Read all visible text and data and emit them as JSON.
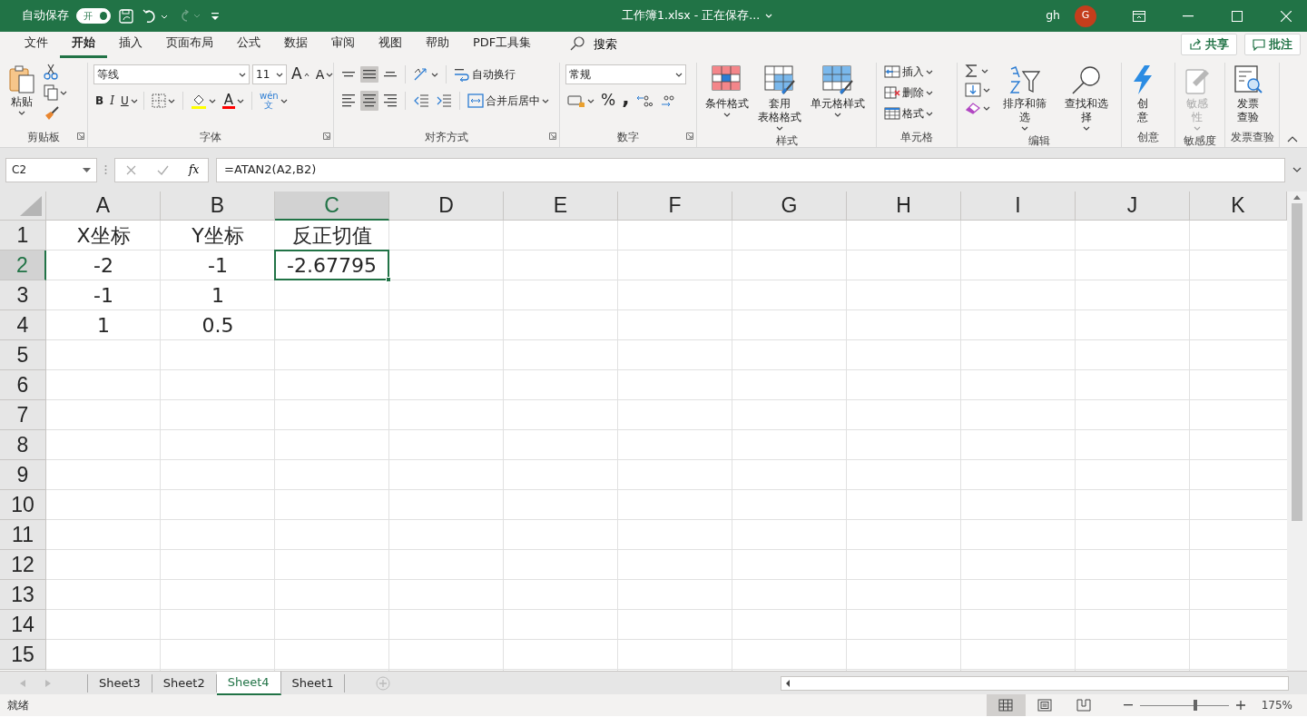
{
  "title_bar": {
    "autosave": {
      "label": "自动保存",
      "toggle_text": "开",
      "on": true
    },
    "redo_disabled": true,
    "title": "工作簿1.xlsx - 正在保存...",
    "user": "gh",
    "avatar": "G"
  },
  "menu_tabs": [
    {
      "label": "文件",
      "selected": false
    },
    {
      "label": "开始",
      "selected": true
    },
    {
      "label": "插入",
      "selected": false
    },
    {
      "label": "页面布局",
      "selected": false
    },
    {
      "label": "公式",
      "selected": false
    },
    {
      "label": "数据",
      "selected": false
    },
    {
      "label": "审阅",
      "selected": false
    },
    {
      "label": "视图",
      "selected": false
    },
    {
      "label": "帮助",
      "selected": false
    },
    {
      "label": "PDF工具集",
      "selected": false
    }
  ],
  "search": "搜索",
  "share": "共享",
  "comments": "批注",
  "ribbon": {
    "clipboard": {
      "label": "剪贴板",
      "launcher": true,
      "paste": "粘贴"
    },
    "font": {
      "label": "字体",
      "launcher": true,
      "font_name": "等线",
      "font_size": "11",
      "grow": "A",
      "shrink": "A",
      "bold": "B",
      "italic": "I",
      "underline": "U",
      "font_color": "A",
      "phonetic_top": "wén",
      "phonetic_bottom": "文"
    },
    "alignment": {
      "label": "对齐方式",
      "launcher": true,
      "vertical": [
        {
          "selected": false
        },
        {
          "selected": true
        },
        {
          "selected": false
        }
      ],
      "horizontal": [
        {
          "selected": false
        },
        {
          "selected": true
        },
        {
          "selected": false
        }
      ],
      "wrap": "自动换行",
      "merge": "合并后居中"
    },
    "number": {
      "label": "数字",
      "launcher": true,
      "format": "常规",
      "percent": "%",
      "comma": ","
    },
    "styles": {
      "label": "样式",
      "items": [
        [
          "条件格式"
        ],
        [
          "套用",
          "表格格式"
        ],
        [
          "单元格样式"
        ]
      ]
    },
    "cells": {
      "label": "单元格",
      "items": [
        "插入",
        "删除",
        "格式"
      ]
    },
    "editing": {
      "label": "编辑",
      "sort": "排序和筛选",
      "find": "查找和选择"
    },
    "ideas": {
      "label": "创意",
      "button": [
        "创",
        "意"
      ],
      "disabled": false
    },
    "sensitivity": {
      "label": "敏感度",
      "button": [
        "敏感",
        "性"
      ],
      "disabled": true
    },
    "invoice": {
      "label": "发票查验",
      "button": [
        "发票",
        "查验"
      ],
      "disabled": false
    }
  },
  "formula_bar": {
    "name_box": "C2",
    "fx": "fx",
    "formula": "=ATAN2(A2,B2)"
  },
  "columns": [
    {
      "label": "A",
      "selected": false
    },
    {
      "label": "B",
      "selected": false
    },
    {
      "label": "C",
      "selected": true
    },
    {
      "label": "D",
      "selected": false
    },
    {
      "label": "E",
      "selected": false
    },
    {
      "label": "F",
      "selected": false
    },
    {
      "label": "G",
      "selected": false
    },
    {
      "label": "H",
      "selected": false
    },
    {
      "label": "I",
      "selected": false
    },
    {
      "label": "J",
      "selected": false
    },
    {
      "label": "K",
      "selected": false
    }
  ],
  "rows": [
    {
      "label": "1",
      "selected": false,
      "cells": [
        {
          "text": "X坐标",
          "selected": false
        },
        {
          "text": "Y坐标",
          "selected": false
        },
        {
          "text": "反正切值",
          "selected": false
        }
      ]
    },
    {
      "label": "2",
      "selected": true,
      "cells": [
        {
          "text": "-2",
          "selected": false
        },
        {
          "text": "-1",
          "selected": false
        },
        {
          "text": "-2.67795",
          "selected": true
        }
      ]
    },
    {
      "label": "3",
      "selected": false,
      "cells": [
        {
          "text": "-1",
          "selected": false
        },
        {
          "text": "1",
          "selected": false
        }
      ]
    },
    {
      "label": "4",
      "selected": false,
      "cells": [
        {
          "text": "1",
          "selected": false
        },
        {
          "text": "0.5",
          "selected": false
        }
      ]
    },
    {
      "label": "5",
      "selected": false,
      "cells": []
    },
    {
      "label": "6",
      "selected": false,
      "cells": []
    },
    {
      "label": "7",
      "selected": false,
      "cells": []
    },
    {
      "label": "8",
      "selected": false,
      "cells": []
    },
    {
      "label": "9",
      "selected": false,
      "cells": []
    },
    {
      "label": "10",
      "selected": false,
      "cells": []
    },
    {
      "label": "11",
      "selected": false,
      "cells": []
    },
    {
      "label": "12",
      "selected": false,
      "cells": []
    },
    {
      "label": "13",
      "selected": false,
      "cells": []
    },
    {
      "label": "14",
      "selected": false,
      "cells": []
    },
    {
      "label": "15",
      "selected": false,
      "cells": []
    }
  ],
  "sheet_tabs": [
    {
      "label": "Sheet3",
      "selected": false
    },
    {
      "label": "Sheet2",
      "selected": false
    },
    {
      "label": "Sheet4",
      "selected": true
    },
    {
      "label": "Sheet1",
      "selected": false
    }
  ],
  "status_bar": {
    "status": "就绪",
    "views": [
      {
        "selected": true
      },
      {
        "selected": false
      },
      {
        "selected": false
      }
    ],
    "zoom": {
      "level": 0.63,
      "reading": "175%"
    }
  }
}
